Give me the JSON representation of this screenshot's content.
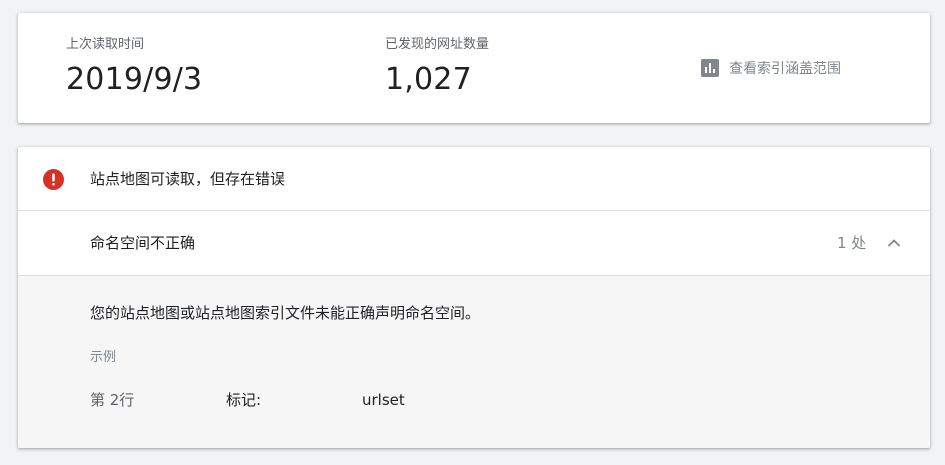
{
  "stats": {
    "last_read_label": "上次读取时间",
    "last_read_value": "2019/9/3",
    "discovered_label": "已发现的网址数量",
    "discovered_value": "1,027",
    "coverage_link": {
      "icon": "bar-chart-icon",
      "label": "查看索引涵盖范围"
    }
  },
  "error_summary": {
    "icon": "error-icon",
    "icon_color": "#d93025",
    "title": "站点地图可读取，但存在错误"
  },
  "issue": {
    "title": "命名空间不正确",
    "count": "1 处",
    "toggle_icon": "chevron-up-icon",
    "description": "您的站点地图或站点地图索引文件未能正确声明命名空间。",
    "example_label": "示例",
    "example_row": {
      "line": "第 2行",
      "tag_label": "标记:",
      "tag_value": "urlset"
    }
  }
}
